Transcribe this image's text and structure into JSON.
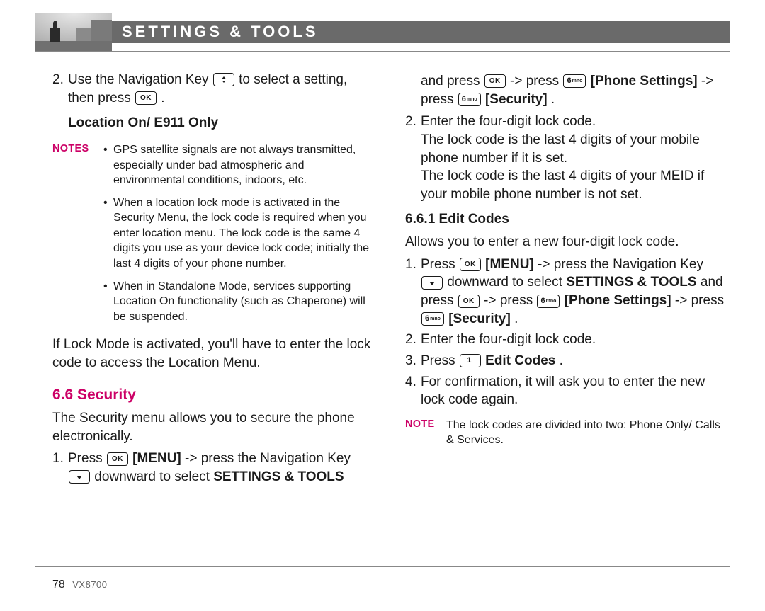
{
  "header_title": "SETTINGS & TOOLS",
  "page_number": "78",
  "model": "VX8700",
  "left": {
    "step2_a": "Use the Navigation Key ",
    "step2_b": " to select a setting, then press ",
    "step2_c": ".",
    "loc_sub": "Location On/ E911 Only",
    "notes_label": "NOTES",
    "note1": "GPS satellite signals are not always transmitted, especially under bad atmospheric and environmental conditions, indoors, etc.",
    "note2": "When a location lock mode is activated in the Security Menu, the lock code is required when you enter location menu. The lock code is the same 4 digits you use as your device lock code; initially the last 4 digits of your phone number.",
    "note3": "When in Standalone Mode, services supporting Location On functionality (such as Chaperone) will be suspended.",
    "lockmode": "If Lock Mode is activated, you'll have to enter the lock code to access the Location Menu.",
    "sec_head": "6.6 Security",
    "sec_intro": "The Security menu allows you to secure the phone electronically.",
    "s1_a": "Press ",
    "s1_menu": " [MENU]",
    "s1_b": " -> press the Navigation Key ",
    "s1_c": " downward to select ",
    "s1_settools": "SETTINGS & TOOLS"
  },
  "right": {
    "r0_a": "and press ",
    "r0_b": " -> press ",
    "r0_phone": " [Phone Settings]",
    "r0_c": " -> press ",
    "r0_security": " [Security]",
    "r0_d": ".",
    "r2": "Enter the four-digit lock code.",
    "r2_exp1": "The lock code is the last 4 digits of your mobile phone number if it is set.",
    "r2_exp2": "The lock code is the last 4 digits of your MEID if your mobile phone number is not set.",
    "sub_edit": "6.6.1 Edit Codes",
    "ec_intro": "Allows you to enter a new four-digit lock code.",
    "ec1_a": "Press ",
    "ec1_menu": " [MENU]",
    "ec1_b": " -> press the Navigation Key ",
    "ec1_c": " downward to select ",
    "ec1_settools": "SETTINGS & TOOLS",
    "ec1_d": " and press ",
    "ec1_e": " -> press ",
    "ec1_phone": " [Phone Settings]",
    "ec1_f": " -> press ",
    "ec1_security": " [Security]",
    "ec1_g": ".",
    "ec2": "Enter the four-digit lock code.",
    "ec3_a": "Press ",
    "ec3_b": " Edit Codes",
    "ec3_c": ".",
    "ec4": "For confirmation, it will ask you to enter the new lock code again.",
    "note_label": "NOTE",
    "note_text": "The lock codes are divided into two: Phone Only/ Calls & Services."
  },
  "keys": {
    "ok": "OK",
    "six_label": "6",
    "six_sub": "mno",
    "one_label": "1"
  }
}
